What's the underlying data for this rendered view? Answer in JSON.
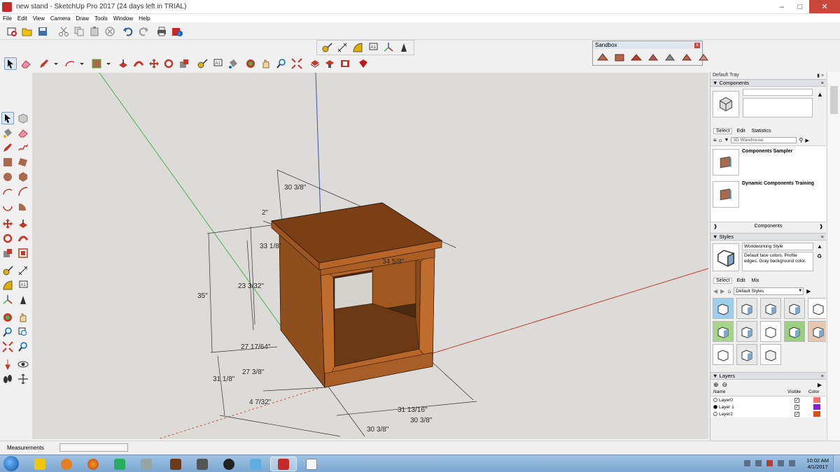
{
  "window": {
    "title": "new stand - SketchUp Pro 2017 (24 days left in TRIAL)",
    "minimize": "–",
    "maximize": "□",
    "close": "✕"
  },
  "menu": [
    "File",
    "Edit",
    "View",
    "Camera",
    "Draw",
    "Tools",
    "Window",
    "Help"
  ],
  "sandbox": {
    "title": "Sandbox",
    "close": "x"
  },
  "viewport": {
    "background": "#dddbd8",
    "dimensions": [
      "30 3/8\"",
      "2\"",
      "33 1/8\"",
      "34 5/8\"",
      "35\"",
      "23 3/32\"",
      "27 17/64\"",
      "27 3/8\"",
      "31 1/8\"",
      "4 7/32\"",
      "31 13/16\"",
      "30 3/8\"",
      "30 3/8\""
    ]
  },
  "status": {
    "measurements_label": "Measurements",
    "measurements_value": ""
  },
  "tray": {
    "title": "Default Tray",
    "components": {
      "header": "Components",
      "tabs": [
        "Select",
        "Edit",
        "Statistics"
      ],
      "search_placeholder": "3D Warehouse",
      "items": [
        "Components Sampler",
        "Dynamic Components Training"
      ],
      "footer": "Components"
    },
    "styles": {
      "header": "Styles",
      "style_name": "Woodworking Style",
      "style_desc": "Default face colors. Profile edges. Gray background color.",
      "tabs": [
        "Select",
        "Edit",
        "Mix"
      ],
      "collection": "Default Styles"
    },
    "layers": {
      "header": "Layers",
      "columns": [
        "Name",
        "Visible",
        "Color"
      ],
      "rows": [
        {
          "name": "Layer0",
          "visible": "✓",
          "color": "#f26d6d",
          "active": false
        },
        {
          "name": "Layer 1",
          "visible": "✓",
          "color": "#8b1fd8",
          "active": true
        },
        {
          "name": "Layer2",
          "visible": "✓",
          "color": "#e04b1a",
          "active": false
        }
      ]
    }
  },
  "taskbar": {
    "time": "10:02 AM",
    "date": "4/1/2017"
  },
  "icons": [
    "new-file-icon",
    "open-icon",
    "save-icon",
    "cut-icon",
    "copy-icon",
    "paste-icon",
    "erase-icon",
    "undo-icon",
    "redo-icon",
    "print-icon",
    "model-info-icon",
    "select-icon",
    "eraser-icon",
    "pencil-icon",
    "arc-icon",
    "rectangle-icon",
    "push-pull-icon",
    "follow-me-icon",
    "move-icon",
    "rotate-icon",
    "scale-icon",
    "tape-measure-icon",
    "text-icon",
    "axes-icon",
    "orbit-icon",
    "pan-icon",
    "zoom-icon",
    "zoom-extents-icon",
    "warehouse-icon",
    "extension-warehouse-icon",
    "layout-icon",
    "ruby-icon"
  ],
  "colors": {
    "wood": "#8b4d1e",
    "wood_light": "#b8652a",
    "wood_dark": "#5e3312",
    "axis_green": "#4caf50",
    "axis_red": "#c0392b",
    "axis_blue": "#3f51b5"
  }
}
